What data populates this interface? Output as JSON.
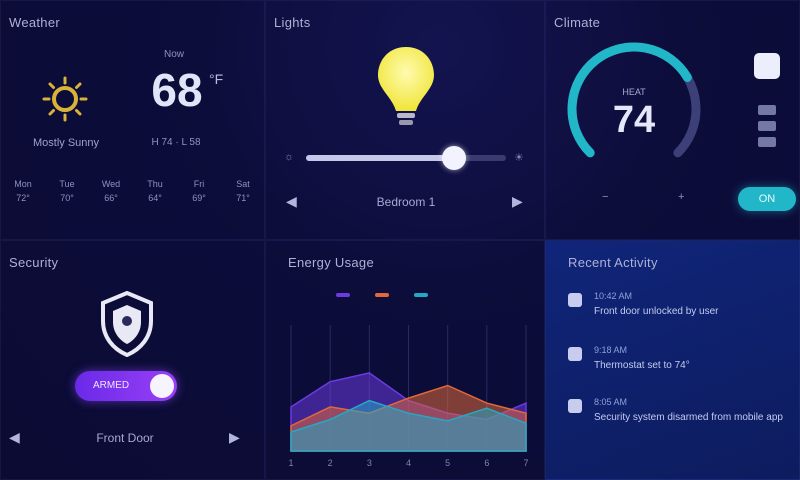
{
  "weather": {
    "title": "Weather",
    "condition": "Mostly Sunny",
    "now_label": "Now",
    "temperature": "68",
    "unit": "°F",
    "hilo": "H 74 · L 58",
    "forecast": [
      {
        "day": "Mon",
        "temp": "72°"
      },
      {
        "day": "Tue",
        "temp": "70°"
      },
      {
        "day": "Wed",
        "temp": "66°"
      },
      {
        "day": "Thu",
        "temp": "64°"
      },
      {
        "day": "Fri",
        "temp": "69°"
      },
      {
        "day": "Sat",
        "temp": "71°"
      }
    ]
  },
  "lights": {
    "title": "Lights",
    "brightness_pct": 74,
    "min_label": "☼",
    "max_label": "☀",
    "room": "Bedroom 1",
    "prev_icon": "chevron-left-icon",
    "next_icon": "chevron-right-icon",
    "bulb_color": "#f4ef5a"
  },
  "climate": {
    "title": "Climate",
    "mode_label": "HEAT",
    "setpoint": "74",
    "setpoint_fraction": 0.72,
    "min_label": "−",
    "max_label": "+",
    "power_label": "ON",
    "accent": "#21b7c9"
  },
  "security": {
    "title": "Security",
    "toggle_label": "ARMED",
    "toggle_on": true,
    "status": "Front Door",
    "accent": "#7a34f0"
  },
  "energy": {
    "title": "Energy Usage",
    "legend": [
      {
        "name": "",
        "color": "#6a3be0"
      },
      {
        "name": "",
        "color": "#e0683a"
      },
      {
        "name": "",
        "color": "#25a8c4"
      }
    ]
  },
  "chart_data": {
    "type": "area",
    "title": "Energy Usage",
    "x": [
      "1",
      "2",
      "3",
      "4",
      "5",
      "6",
      "7"
    ],
    "ylim": [
      0,
      100
    ],
    "series": [
      {
        "values": [
          35,
          55,
          62,
          40,
          30,
          25,
          38
        ]
      },
      {
        "values": [
          20,
          35,
          30,
          42,
          52,
          38,
          30
        ]
      },
      {
        "values": [
          15,
          25,
          40,
          30,
          24,
          34,
          22
        ]
      }
    ]
  },
  "activity": {
    "title": "Recent Activity",
    "items": [
      {
        "time": "10:42 AM",
        "text": "Front door unlocked by user"
      },
      {
        "time": "9:18 AM",
        "text": "Thermostat set to 74°"
      },
      {
        "time": "8:05 AM",
        "text": "Security system disarmed from mobile app"
      }
    ]
  }
}
